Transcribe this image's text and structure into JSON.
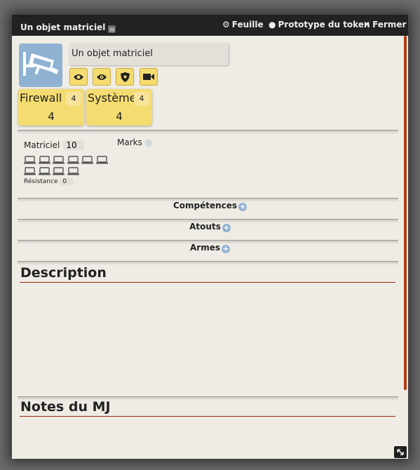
{
  "window": {
    "title": "Un objet matriciel",
    "header_buttons": {
      "sheet": "Feuille",
      "token": "Prototype du token",
      "close": "Fermer"
    }
  },
  "actor": {
    "name": "Un objet matriciel",
    "portrait_icon": "security-camera-icon",
    "mode_icons": [
      "eye-icon",
      "eye-shield-icon",
      "shield-icon",
      "video-camera-icon"
    ]
  },
  "attributes": [
    {
      "label": "Firewall",
      "max": "4",
      "value": "4"
    },
    {
      "label": "Système",
      "max": "4",
      "value": "4"
    }
  ],
  "matrix": {
    "label": "Matriciel",
    "value": "10",
    "marks_label": "Marks",
    "marks_icon": "fingerprint-icon",
    "monitor_boxes": 10,
    "resistance_label": "Résistance",
    "resistance_value": "0"
  },
  "sections": {
    "skills": "Compétences",
    "edges": "Atouts",
    "weapons": "Armes",
    "description": "Description",
    "gm_notes": "Notes du MJ"
  }
}
